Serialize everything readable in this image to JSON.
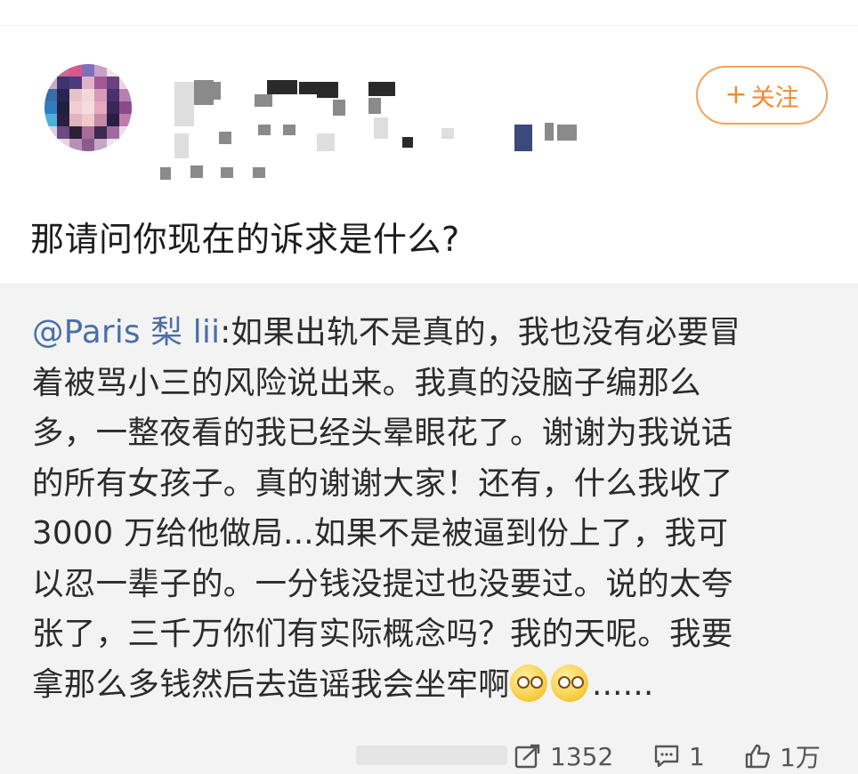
{
  "header": {
    "follow_label": "关注",
    "follow_plus": "+"
  },
  "post": {
    "question": "那请问你现在的诉求是什么?"
  },
  "quote": {
    "mention": "@Paris 梨 lii",
    "lines": [
      ":如果出轨不是真的，我也没有必要冒",
      "着被骂小三的风险说出来。我真的没脑子编那么",
      "多，一整夜看的我已经头晕眼花了。谢谢为我说话",
      "的所有女孩子。真的谢谢大家！还有，什么我收了",
      "3000 万给他做局...如果不是被逼到份上了，我可",
      "以忍一辈子的。一分钱没提过也没要过。说的太夸",
      "张了，三千万你们有实际概念吗？我的天呢。我要",
      "拿那么多钱然后去造谣我会坐牢啊"
    ],
    "ellipsis": "......"
  },
  "stats": {
    "repost_count": "1352",
    "comment_count": "1",
    "like_count": "1万"
  },
  "colors": {
    "accent": "#ef8a2e",
    "mention": "#4a6fa5",
    "quote_bg": "#f3f3f3"
  }
}
